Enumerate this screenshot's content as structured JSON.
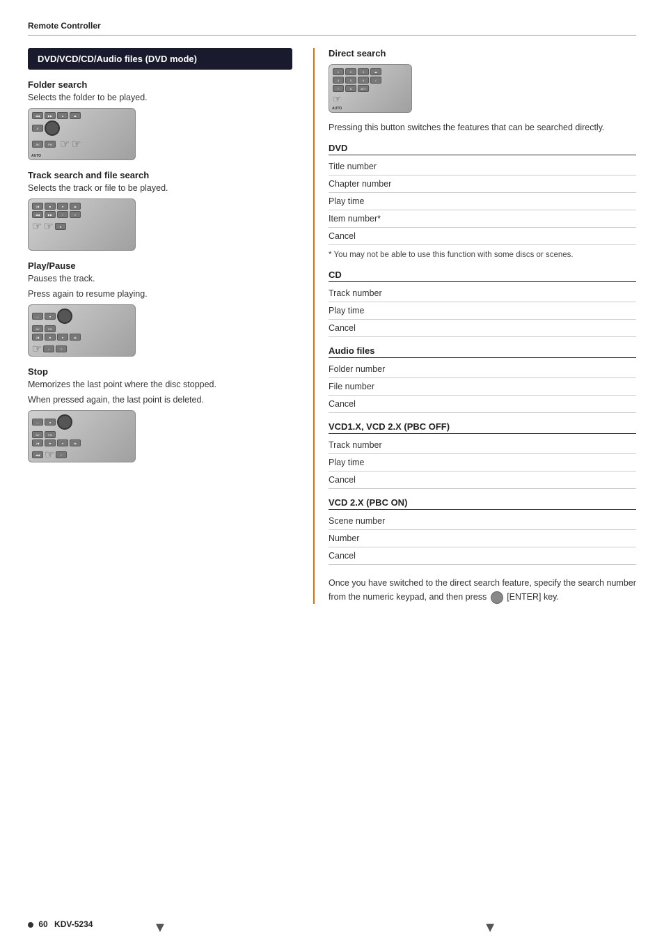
{
  "page": {
    "header": "Remote Controller",
    "footer": "60",
    "model": "KDV-5234"
  },
  "left_section": {
    "box_title": "DVD/VCD/CD/Audio files (DVD mode)",
    "subsections": [
      {
        "id": "folder-search",
        "title": "Folder search",
        "description": "Selects the folder to be played."
      },
      {
        "id": "track-search",
        "title": "Track search and file search",
        "description": "Selects the track or file to be played."
      },
      {
        "id": "play-pause",
        "title": "Play/Pause",
        "lines": [
          "Pauses the track.",
          "Press again to resume playing."
        ]
      },
      {
        "id": "stop",
        "title": "Stop",
        "lines": [
          "Memorizes the last point where the disc stopped.",
          "When pressed again, the last point is deleted."
        ]
      }
    ]
  },
  "right_section": {
    "title": "Direct search",
    "switch_text": "Pressing this button switches the features that can be searched directly.",
    "categories": [
      {
        "id": "dvd",
        "header": "DVD",
        "items": [
          "Title number",
          "Chapter number",
          "Play time",
          "Item number*",
          "Cancel"
        ],
        "footnote": "* You may not be able to use this function with some discs or scenes."
      },
      {
        "id": "cd",
        "header": "CD",
        "items": [
          "Track number",
          "Play time",
          "Cancel"
        ]
      },
      {
        "id": "audio-files",
        "header": "Audio files",
        "items": [
          "Folder number",
          "File number",
          "Cancel"
        ]
      },
      {
        "id": "vcd1x",
        "header": "VCD1.X, VCD 2.X (PBC OFF)",
        "items": [
          "Track number",
          "Play time",
          "Cancel"
        ]
      },
      {
        "id": "vcd2x-pbc-on",
        "header": "VCD 2.X (PBC ON)",
        "items": [
          "Scene number",
          "Number",
          "Cancel"
        ]
      }
    ],
    "bottom_note": "Once you have switched to the direct search feature, specify the search number from the numeric keypad, and then press",
    "bottom_note_end": "[ENTER] key."
  }
}
